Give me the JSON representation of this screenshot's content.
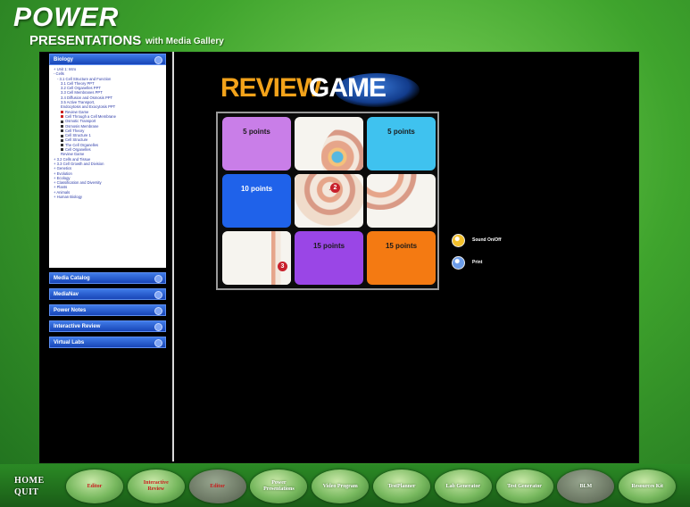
{
  "header": {
    "title": "POWER",
    "subtitle": "PRESENTATIONS",
    "tagline": "with Media Gallery"
  },
  "sidebar": {
    "tree_header": "Biology",
    "tree_items": [
      {
        "label": "+ Unit 1: Intro",
        "style": "plain"
      },
      {
        "label": "- Cells",
        "style": "plain"
      },
      {
        "label": "- 3.1 Cell Structure and Function",
        "style": "plain"
      },
      {
        "label": "3.1 Cell Theory PPT",
        "style": "plain"
      },
      {
        "label": "3.2 Cell Organelles PPT",
        "style": "plain"
      },
      {
        "label": "3.3 Cell Membranes PPT",
        "style": "plain"
      },
      {
        "label": "3.4 Diffusion and Osmosis PPT",
        "style": "plain"
      },
      {
        "label": "3.5 Active Transport,",
        "style": "plain"
      },
      {
        "label": "Endocytosis and Exocytosis PPT",
        "style": "plain"
      },
      {
        "label": "Review Game",
        "style": "red"
      },
      {
        "label": "Cell Through a Cell Membrane",
        "style": "red"
      },
      {
        "label": "Osmotic Transport",
        "style": "dark"
      },
      {
        "label": "Osmosis Membrane",
        "style": "dark"
      },
      {
        "label": "Cell Theory",
        "style": "dark"
      },
      {
        "label": "Cell Structure 1",
        "style": "dark"
      },
      {
        "label": "Cell Structure",
        "style": "dark"
      },
      {
        "label": "The Cell Organelles",
        "style": "dark"
      },
      {
        "label": "Cell Organelles",
        "style": "dark"
      },
      {
        "label": "Review Game",
        "style": "plain"
      },
      {
        "label": "+ 3.2 Cells and Tissue",
        "style": "plain"
      },
      {
        "label": "+ 3.3 Cell Growth and Division",
        "style": "plain"
      },
      {
        "label": "+ Genetics",
        "style": "plain"
      },
      {
        "label": "+ Evolution",
        "style": "plain"
      },
      {
        "label": "+ Ecology",
        "style": "plain"
      },
      {
        "label": "+ Classification and Diversity",
        "style": "plain"
      },
      {
        "label": "+ Plants",
        "style": "plain"
      },
      {
        "label": "+ Animals",
        "style": "plain"
      },
      {
        "label": "+ Human Biology",
        "style": "plain"
      }
    ],
    "sections": [
      "Media Catalog",
      "MediaNav",
      "Power Notes",
      "Interactive Review",
      "Virtual Labs"
    ]
  },
  "game": {
    "logo_part1": "REVIEW",
    "logo_part2": "GAME",
    "tiles": [
      {
        "label": "5 points",
        "color": "#c97ee8"
      },
      {
        "label": "",
        "color": "image"
      },
      {
        "label": "5 points",
        "color": "#3fc2ef"
      },
      {
        "label": "10 points",
        "color": "#1f62ea"
      },
      {
        "label": "",
        "color": "image"
      },
      {
        "label": "",
        "color": "image"
      },
      {
        "label": "",
        "color": "image"
      },
      {
        "label": "15 points",
        "color": "#9a46e6"
      },
      {
        "label": "15 points",
        "color": "#f47a12"
      }
    ],
    "markers": [
      "2",
      "3"
    ],
    "controls": [
      {
        "label": "Sound On/Off",
        "icon": "sound-icon",
        "color": "#f3c02b"
      },
      {
        "label": "Print",
        "icon": "print-icon",
        "color": "#6c9ce9"
      }
    ]
  },
  "footer": {
    "home_label": "HOME",
    "quit_label": "QUIT",
    "nav": [
      {
        "label": "Editor",
        "style": "red"
      },
      {
        "label": "Interactive Review",
        "style": "red"
      },
      {
        "label": "Editor",
        "style": "red-dim"
      },
      {
        "label": "Power Presentations",
        "style": "white"
      },
      {
        "label": "Video Program",
        "style": "white"
      },
      {
        "label": "TestPlanner",
        "style": "white"
      },
      {
        "label": "Lab Generator",
        "style": "white"
      },
      {
        "label": "Test Generator",
        "style": "white"
      },
      {
        "label": "BLM",
        "style": "white-dim"
      },
      {
        "label": "Resources Kit",
        "style": "white"
      }
    ]
  }
}
